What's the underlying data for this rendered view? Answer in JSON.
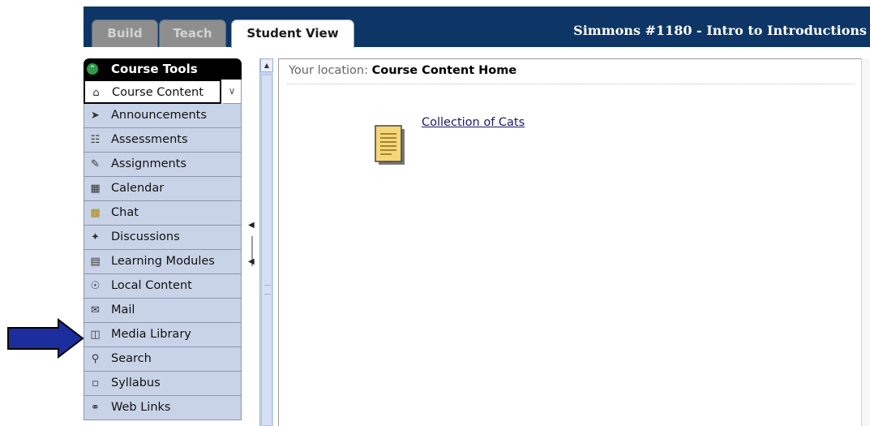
{
  "tabs": [
    {
      "label": "Build",
      "state": "inactive"
    },
    {
      "label": "Teach",
      "state": "inactive"
    },
    {
      "label": "Student View",
      "state": "active"
    }
  ],
  "course_title": "Simmons #1180 - Intro to Introductions",
  "sidebar": {
    "header": "Course Tools",
    "items": [
      {
        "label": "Course Content",
        "icon": "home-icon",
        "current": true
      },
      {
        "label": "Announcements",
        "icon": "megaphone-icon"
      },
      {
        "label": "Assessments",
        "icon": "assessment-icon"
      },
      {
        "label": "Assignments",
        "icon": "assignment-icon"
      },
      {
        "label": "Calendar",
        "icon": "calendar-icon"
      },
      {
        "label": "Chat",
        "icon": "chat-icon"
      },
      {
        "label": "Discussions",
        "icon": "pushpin-icon"
      },
      {
        "label": "Learning Modules",
        "icon": "module-icon"
      },
      {
        "label": "Local Content",
        "icon": "cd-icon"
      },
      {
        "label": "Mail",
        "icon": "envelope-icon"
      },
      {
        "label": "Media Library",
        "icon": "media-icon"
      },
      {
        "label": "Search",
        "icon": "magnifier-icon"
      },
      {
        "label": "Syllabus",
        "icon": "syllabus-icon"
      },
      {
        "label": "Web Links",
        "icon": "globe-icon"
      }
    ]
  },
  "content": {
    "location_prefix": "Your location:",
    "location_current": "Course Content Home",
    "items": [
      {
        "title": "Collection of Cats",
        "icon": "document-icon"
      }
    ]
  },
  "colors": {
    "header_bg": "#0d3667",
    "sidebar_item_bg": "#c9d3e8",
    "arrow": "#1c2d9e"
  }
}
